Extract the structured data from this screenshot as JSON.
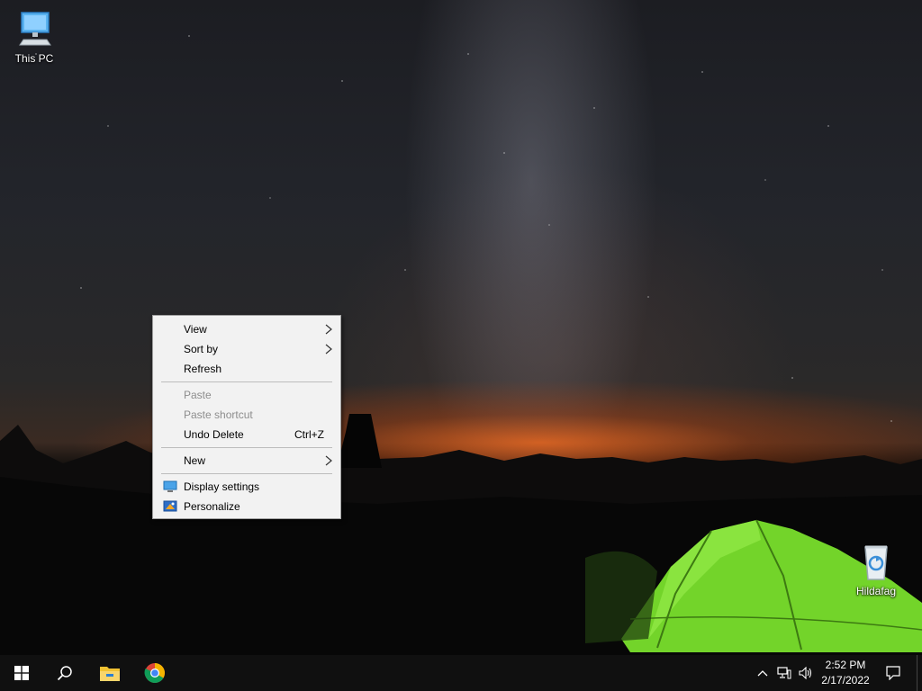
{
  "desktop": {
    "icons": [
      {
        "label": "This PC",
        "icon": "computer-icon"
      },
      {
        "label": "Hildafag",
        "icon": "recycle-bin-icon"
      }
    ]
  },
  "context_menu": {
    "items": [
      {
        "label": "View",
        "has_submenu": true,
        "enabled": true
      },
      {
        "label": "Sort by",
        "has_submenu": true,
        "enabled": true
      },
      {
        "label": "Refresh",
        "enabled": true
      },
      {
        "label": "Paste",
        "enabled": false
      },
      {
        "label": "Paste shortcut",
        "enabled": false
      },
      {
        "label": "Undo Delete",
        "shortcut": "Ctrl+Z",
        "enabled": true
      },
      {
        "label": "New",
        "has_submenu": true,
        "enabled": true
      },
      {
        "label": "Display settings",
        "icon": "display-icon",
        "enabled": true
      },
      {
        "label": "Personalize",
        "icon": "personalize-icon",
        "enabled": true
      }
    ]
  },
  "taskbar": {
    "pinned": [
      "windows-start-icon",
      "search-icon",
      "file-explorer-icon",
      "chrome-icon"
    ],
    "tray": [
      "chevron-up-icon",
      "network-icon",
      "volume-icon"
    ],
    "clock": {
      "time": "2:52 PM",
      "date": "2/17/2022"
    },
    "notification": "notification-icon"
  },
  "colors": {
    "taskbar": "#101010",
    "menu_bg": "#f2f2f2",
    "tent": "#7ee02a",
    "start_blue": "#ffffff"
  }
}
